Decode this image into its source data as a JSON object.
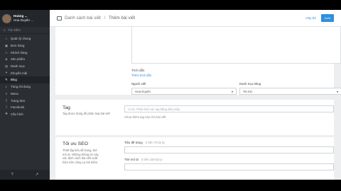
{
  "sidebar": {
    "user_name": "Hoàng ...",
    "user_store": "Hoa Duyên ...",
    "search_label": "Tìm kiếm",
    "items": [
      {
        "icon": "home-icon",
        "glyph": "⌂",
        "label": "Quản lý chung"
      },
      {
        "icon": "cart-icon",
        "glyph": "▣",
        "label": "Đơn hàng"
      },
      {
        "icon": "users-icon",
        "glyph": "☺",
        "label": "Khách hàng"
      },
      {
        "icon": "tag-icon",
        "glyph": "◈",
        "label": "Sản phẩm"
      },
      {
        "icon": "folder-icon",
        "glyph": "▤",
        "label": "Danh mục"
      },
      {
        "icon": "gift-icon",
        "glyph": "✦",
        "label": "Khuyến mãi"
      },
      {
        "icon": "blog-icon",
        "glyph": "✎",
        "label": "Blog"
      },
      {
        "icon": "palette-icon",
        "glyph": "◐",
        "label": "Tùng chỉ dung"
      },
      {
        "icon": "menu-icon",
        "glyph": "≡",
        "label": "Menu"
      },
      {
        "icon": "page-icon",
        "glyph": "▯",
        "label": "Trang đơn"
      },
      {
        "icon": "facebook-icon",
        "glyph": "f",
        "label": "Facebook"
      },
      {
        "icon": "settings-icon",
        "glyph": "✚",
        "label": "Cấu hình"
      }
    ],
    "bottom_help": "?",
    "bottom_external": "↗"
  },
  "topbar": {
    "crumb_parent": "Danh sách bài viết",
    "crumb_separator": "/",
    "crumb_current": "Thêm bài viết",
    "cancel_label": "Hủy bỏ",
    "save_label": "Lưu"
  },
  "post_form": {
    "excerpt_label": "Trích dẫn",
    "excerpt_link": "Thêm trích dẫn",
    "author_label": "Người viết",
    "author_value": "Hoa Duyên",
    "category_label": "Danh mục Blog",
    "category_value": "Tin tức"
  },
  "tag_section": {
    "title": "Tag",
    "description": "Tag được dùng để phân loại bài viết",
    "input_placeholder": "Ví dụ: Phân biệt các tag bằng dấu phẩy",
    "hint": "Chưa thêm tag nào cho bài viết"
  },
  "seo_section": {
    "title": "Tối ưu SEO",
    "description": "Thiết lập tiêu đề trang, thẻ mô tả. Những thông tin này xác định cách bài viết xuất hiện trên công cụ tìm kiếm.",
    "page_title_label": "Tiêu đề trang",
    "page_title_count": "0 trên 70 ký tự",
    "description_label": "Thẻ mô tả",
    "description_count": "0 trên 160 ký tự"
  },
  "colors": {
    "accent": "#2f8fdc",
    "sidebar_bg": "#2b2f33",
    "page_bg": "#eceef0"
  }
}
